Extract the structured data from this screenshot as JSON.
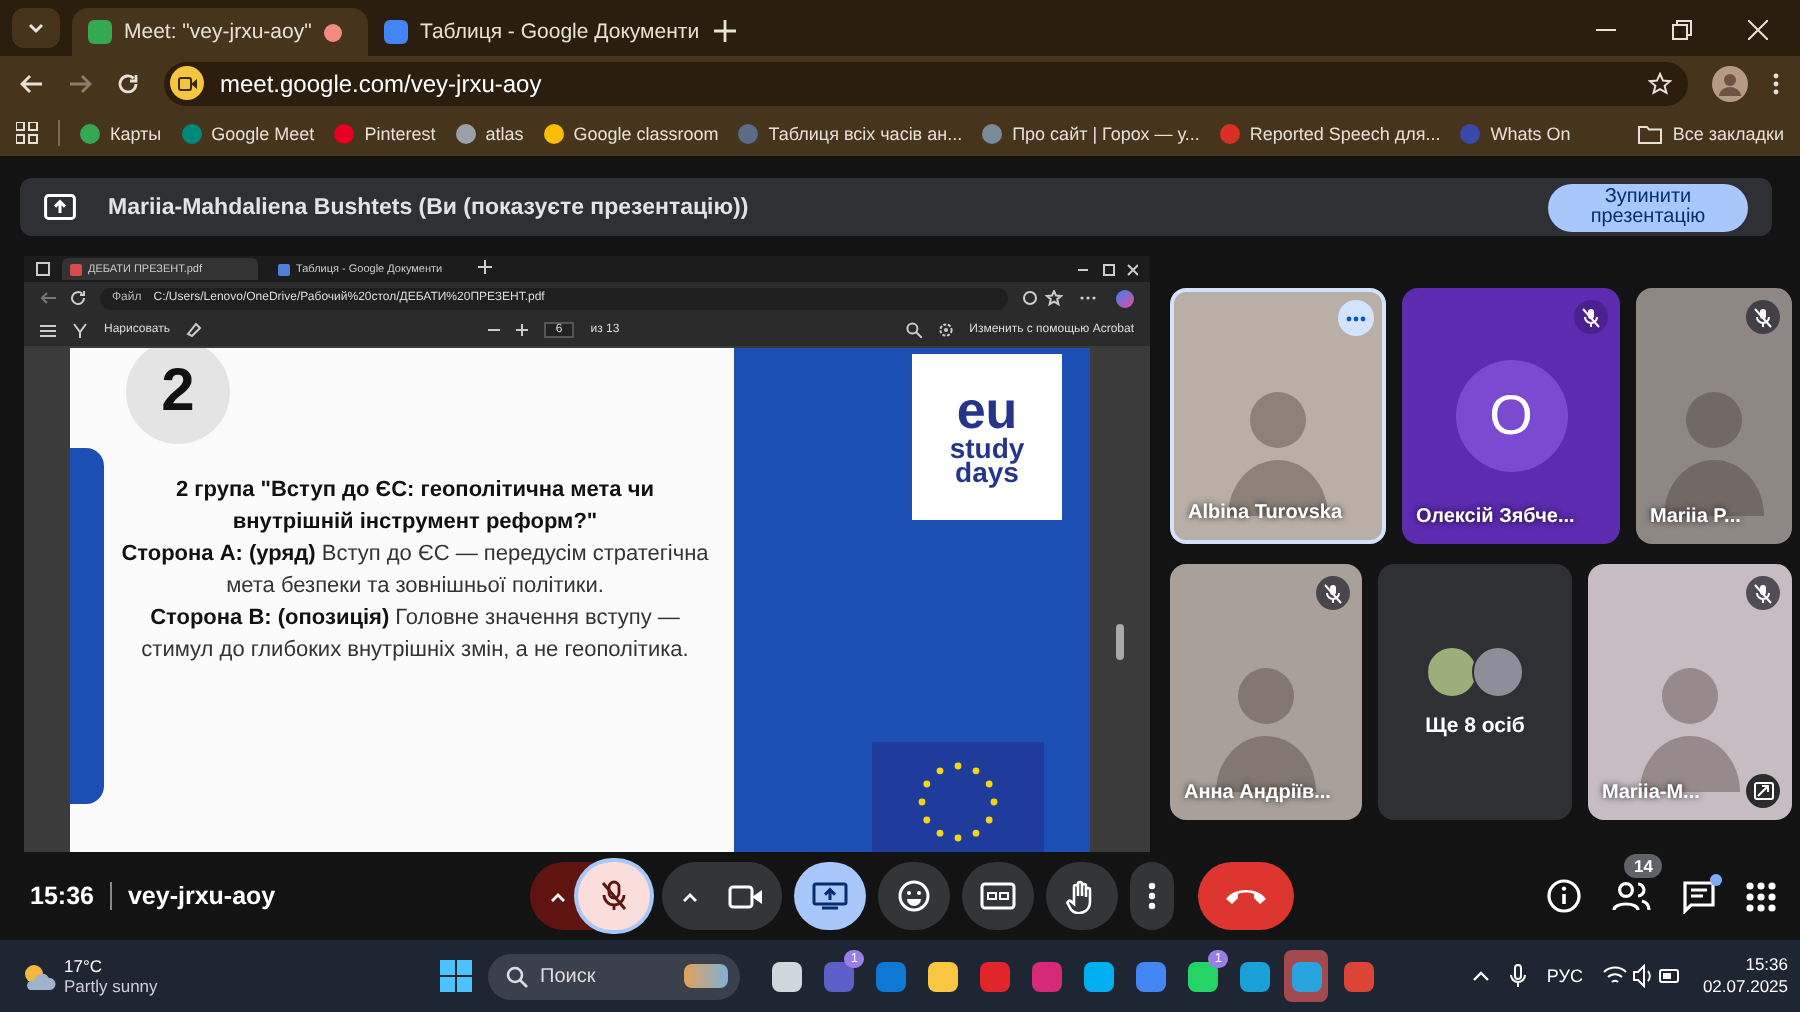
{
  "browser": {
    "tabs": [
      {
        "kind": "meet",
        "title": "Meet: \"vey-jrxu-aoy\"",
        "selected": true,
        "recording": true
      },
      {
        "kind": "docs",
        "title": "Таблиця - Google Документи",
        "selected": false,
        "recording": false
      }
    ],
    "url": "meet.google.com/vey-jrxu-aoy",
    "bookmarks": [
      {
        "label": "Карты",
        "color": "#34a853"
      },
      {
        "label": "Google Meet",
        "color": "#00897b"
      },
      {
        "label": "Pinterest",
        "color": "#e60023"
      },
      {
        "label": "atlas",
        "color": "#9aa0a6"
      },
      {
        "label": "Google classroom",
        "color": "#fbbc04"
      },
      {
        "label": "Таблиця всіх часів ан...",
        "color": "#5c6b8a"
      },
      {
        "label": "Про сайт | Горох — у...",
        "color": "#7a8a99"
      },
      {
        "label": "Reported Speech для...",
        "color": "#d93025"
      },
      {
        "label": "Whats On",
        "color": "#3949ab"
      }
    ],
    "all_bookmarks": "Все закладки"
  },
  "banner": {
    "text": "Mariia-Mahdaliena Bushtets (Ви (показуєте презентацію))",
    "button": "Зупинити презентацію"
  },
  "shared_screen": {
    "tabs": [
      {
        "title": "ДЕБАТИ ПРЕЗЕНТ.pdf",
        "selected": true
      },
      {
        "title": "Таблиця - Google Документи",
        "selected": false
      }
    ],
    "file_label": "Файл",
    "path": "C:/Users/Lenovo/OneDrive/Рабочий%20стол/ДЕБАТИ%20ПРЕЗЕНТ.pdf",
    "draw_label": "Нарисовать",
    "page": "6",
    "page_count": "из 13",
    "acrobat": "Изменить с помощью Acrobat",
    "slide": {
      "number": "2",
      "title": "2 група \"Вступ до ЄС: геополітична мета чи внутрішній інструмент реформ?\"",
      "sides": [
        "**Сторона А: (уряд)** Вступ до ЄС — передусім стратегічна мета безпеки та зовнішньої політики.",
        "**Сторона В: (опозиція)** Головне значення вступу — стимул до глибоких внутрішніх змін, а не геополітика."
      ],
      "logo": [
        "eu",
        "study",
        "days"
      ]
    }
  },
  "tiles": [
    {
      "kind": "video",
      "name": "Albina Turovska",
      "muted": false,
      "hovered": true
    },
    {
      "kind": "avatar",
      "name": "Олексій Зябче...",
      "initial": "О",
      "muted": true,
      "hovered": false
    },
    {
      "kind": "video",
      "name": "Mariia P...",
      "muted": true,
      "hovered": false
    },
    {
      "kind": "video",
      "name": "Анна Андріїв...",
      "muted": true,
      "hovered": false
    },
    {
      "kind": "more",
      "label": "Ще 8 осіб"
    },
    {
      "kind": "self",
      "name": "Mariia-M...",
      "muted": true,
      "hovered": false
    }
  ],
  "call_bar": {
    "time": "15:36",
    "code": "vey-jrxu-aoy",
    "controls": [
      {
        "kind": "mic",
        "on": false
      },
      {
        "kind": "camera",
        "on": true
      },
      {
        "kind": "present",
        "on": true
      },
      {
        "kind": "emoji",
        "on": false
      },
      {
        "kind": "captions",
        "on": false
      },
      {
        "kind": "hand",
        "on": false
      },
      {
        "kind": "more",
        "on": false
      },
      {
        "kind": "leave",
        "on": false
      }
    ],
    "people_count": "14",
    "chat_unread": true
  },
  "taskbar": {
    "temperature": "17°C",
    "weather": "Partly sunny",
    "search_placeholder": "Поиск",
    "apps": [
      {
        "color": "#cfd8dc",
        "selected": false
      },
      {
        "color": "#5b5fc7",
        "badge": "1",
        "selected": false
      },
      {
        "color": "#0f78d4",
        "selected": false
      },
      {
        "color": "#f9c642",
        "selected": false
      },
      {
        "color": "#e0252b",
        "selected": false
      },
      {
        "color": "#d62976",
        "selected": false
      },
      {
        "color": "#00aff0",
        "selected": false
      },
      {
        "color": "#4285f4",
        "selected": false
      },
      {
        "color": "#25d366",
        "badge": "1",
        "selected": false
      },
      {
        "color": "#1aa0d8",
        "selected": false
      },
      {
        "color": "#2aa4df",
        "selected": true
      },
      {
        "color": "#db4437",
        "selected": false
      }
    ],
    "language": "РУС",
    "clock": "15:36",
    "date": "02.07.2025"
  }
}
